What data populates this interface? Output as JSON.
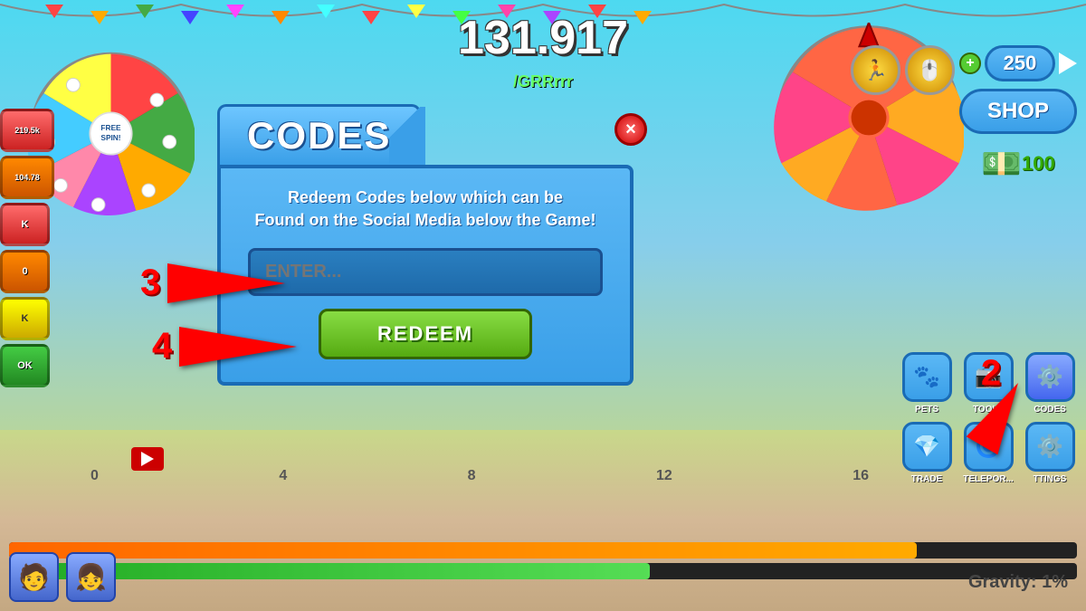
{
  "score": {
    "value": "131,917",
    "display": "131.917"
  },
  "username": "/GRRrrr",
  "dialog": {
    "title": "CODES",
    "description_line1": "Redeem Codes below which can be",
    "description_line2": "Found on the Social Media below the Game!",
    "input_placeholder": "ENTER...",
    "redeem_button": "REDEEM",
    "close_button": "×"
  },
  "currency": {
    "amount": "250",
    "plus_label": "+",
    "play_label": "▶"
  },
  "shop": {
    "label": "SHOP"
  },
  "nav_icons": [
    {
      "id": "pets",
      "emoji": "🐾",
      "label": "PETS"
    },
    {
      "id": "tools",
      "emoji": "📷",
      "label": "TOOLS"
    },
    {
      "id": "codes",
      "emoji": "⚙️",
      "label": "CODES"
    },
    {
      "id": "trade",
      "emoji": "💎",
      "label": "TRADE"
    },
    {
      "id": "teleport",
      "emoji": "🌀",
      "label": "TELEPOR..."
    },
    {
      "id": "settings",
      "emoji": "⚙️",
      "label": "TTINGS"
    }
  ],
  "arrows": {
    "arrow3_label": "3",
    "arrow4_label": "4",
    "arrow2_label": "2"
  },
  "ground_numbers": [
    "0",
    "4",
    "8",
    "12",
    "16"
  ],
  "gravity": {
    "label": "Gravity: 1%"
  },
  "progress_bars": {
    "orange_width": "85%",
    "green_width": "60%"
  },
  "wheel_left": {
    "label": "FREE\nSPIN!"
  },
  "colors": {
    "accent_blue": "#3A9FE8",
    "dialog_bg": "#5BB8F5",
    "button_green": "#55AA11",
    "red": "#FF0000"
  }
}
